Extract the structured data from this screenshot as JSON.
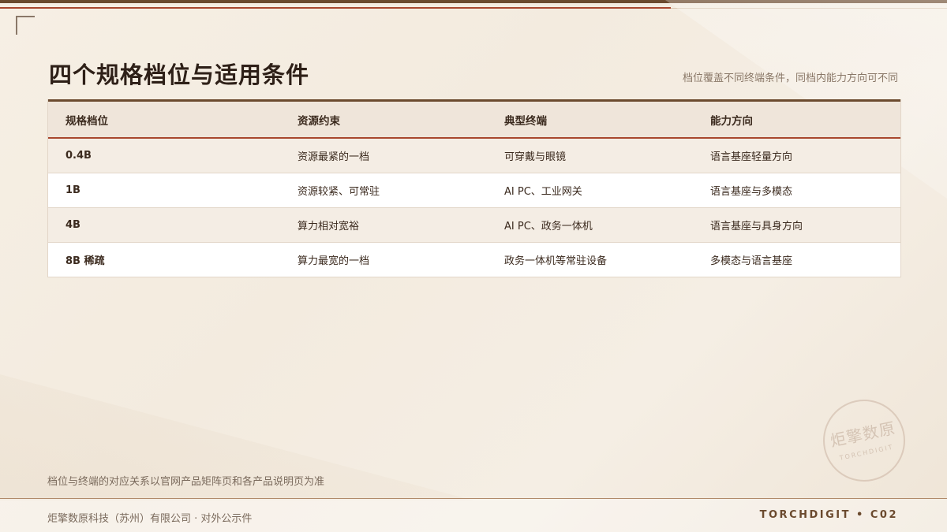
{
  "header": {
    "title": "四个规格档位与适用条件",
    "subtitle": "档位覆盖不同终端条件，同档内能力方向可不同"
  },
  "table": {
    "columns": [
      "规格档位",
      "资源约束",
      "典型终端",
      "能力方向"
    ],
    "rows": [
      [
        "0.4B",
        "资源最紧的一档",
        "可穿戴与眼镜",
        "语言基座轻量方向"
      ],
      [
        "1B",
        "资源较紧、可常驻",
        "AI PC、工业网关",
        "语言基座与多模态"
      ],
      [
        "4B",
        "算力相对宽裕",
        "AI PC、政务一体机",
        "语言基座与具身方向"
      ],
      [
        "8B 稀疏",
        "算力最宽的一档",
        "政务一体机等常驻设备",
        "多模态与语言基座"
      ]
    ]
  },
  "note": "档位与终端的对应关系以官网产品矩阵页和各产品说明页为准",
  "footer": {
    "left": "炬擎数原科技（苏州）有限公司 · 对外公示件",
    "right": "TORCHDIGIT • C02"
  },
  "seal": {
    "main": "炬擎数原",
    "sub": "TORCHDIGIT"
  },
  "colors": {
    "accent": "#a8472e",
    "brand": "#6b4a2e",
    "background": "#f5eee4"
  }
}
